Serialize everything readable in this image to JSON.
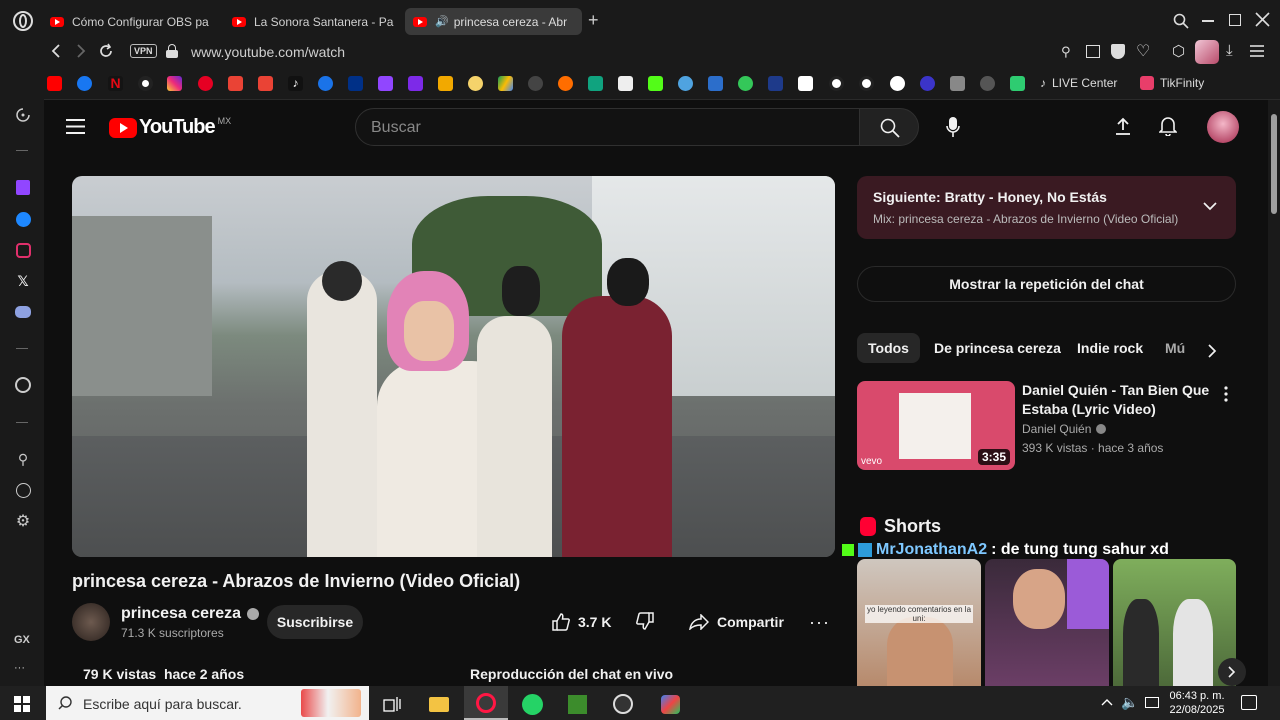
{
  "browser": {
    "tabs": [
      {
        "label": "Cómo Configurar OBS pa"
      },
      {
        "label": "La Sonora Santanera - Pa"
      },
      {
        "label": "princesa cereza - Abr"
      }
    ],
    "new_tab": "+",
    "vpn": "VPN",
    "url": "www.youtube.com/watch",
    "bookmarks": {
      "live_center": "LIVE Center",
      "tikfinity": "TikFinity"
    },
    "sidebar_gx": "GX",
    "sidebar_more": "···"
  },
  "youtube": {
    "logo_text": "YouTube",
    "region": "MX",
    "search_placeholder": "Buscar",
    "video_title": "princesa cereza - Abrazos de Invierno (Video Oficial)",
    "channel_name": "princesa cereza",
    "subscribers": "71.3 K suscriptores",
    "subscribe": "Suscribirse",
    "likes": "3.7 K",
    "share": "Compartir",
    "views": "79 K vistas",
    "age": "hace 2 años",
    "chat_replay_label": "Reproducción del chat en vivo",
    "up_next": {
      "label": "Siguiente:",
      "title": "Bratty - Honey, No Estás",
      "mix": "Mix: princesa cereza - Abrazos de Invierno (Video Oficial)"
    },
    "show_chat_replay": "Mostrar la repetición del chat",
    "chips": [
      "Todos",
      "De princesa cereza",
      "Indie rock",
      "Mú"
    ],
    "recommended": {
      "title_line1": "Daniel Quién - Tan Bien Que",
      "title_line2": "Estaba (Lyric Video)",
      "channel": "Daniel Quién",
      "stats": "393 K vistas · hace 3 años",
      "duration": "3:35",
      "vevo": "vevo"
    },
    "shorts_title": "Shorts",
    "chat_overlay": {
      "user": "MrJonathanA2",
      "message": ": de tung tung sahur xd"
    },
    "shorts_caption": "yo leyendo comentarios en la uni:"
  },
  "taskbar": {
    "search_placeholder": "Escribe aquí para buscar.",
    "time": "06:43 p. m.",
    "date": "22/08/2025"
  }
}
